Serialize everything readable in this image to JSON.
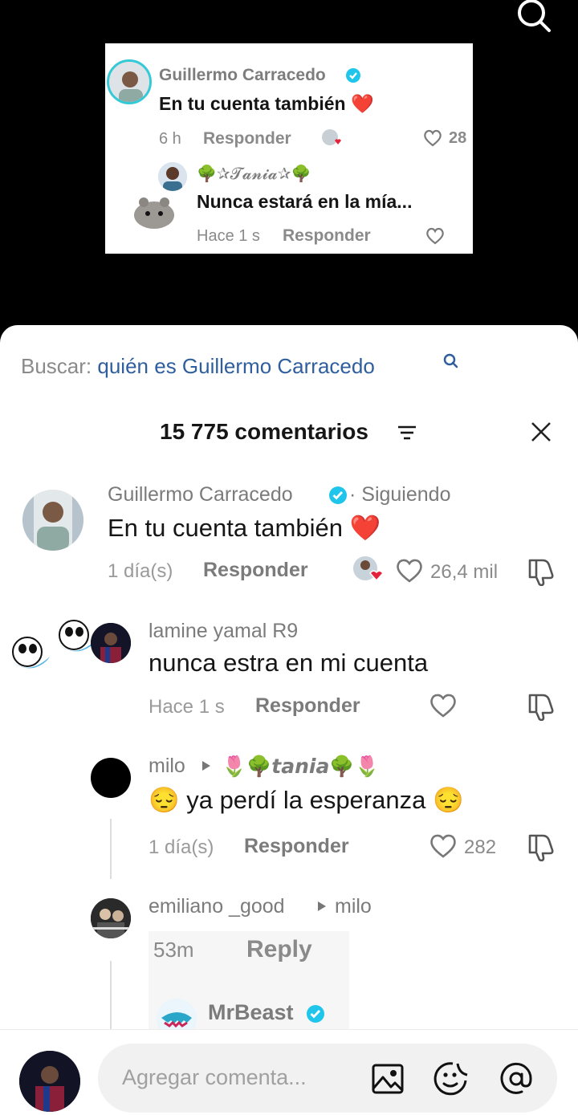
{
  "overlay_card": {
    "author": "Guillermo Carracedo",
    "comment": "En tu cuenta también ❤️",
    "time": "6 h",
    "reply_label": "Responder",
    "likes": "28",
    "reply_author": "🌳✰𝓣𝓪𝓷𝓲𝓪✰🌳",
    "reply_text": "Nunca estará en la mía...",
    "reply_time": "Hace 1 s",
    "reply_reply_label": "Responder"
  },
  "sheet": {
    "search_prefix": "Buscar:",
    "search_query": "quién es Guillermo Carracedo",
    "comment_count": "15 775 comentarios",
    "comments": [
      {
        "author": "Guillermo Carracedo",
        "following": "· Siguiendo",
        "text": "En tu cuenta también ❤️",
        "time": "1 día(s)",
        "reply_label": "Responder",
        "likes": "26,4 mil"
      },
      {
        "author": "lamine yamal R9",
        "text": "nunca estra en mi cuenta",
        "time": "Hace 1 s",
        "reply_label": "Responder"
      },
      {
        "author": "milo",
        "reply_to": "🌷🌳𝙩𝙖𝙣𝙞𝙖🌳🌷",
        "text": "😔 ya perdí la esperanza 😔",
        "time": "1 día(s)",
        "reply_label": "Responder",
        "likes": "282"
      },
      {
        "author": "emiliano _good",
        "reply_to": "milo",
        "embedded_time": "53m",
        "embedded_reply": "Reply",
        "embedded_author": "MrBeast"
      }
    ],
    "input_placeholder": "Agregar comenta..."
  },
  "colors": {
    "search_blue": "#2f5e9e",
    "verified": "#20c5eb",
    "heart": "#e5223b"
  }
}
